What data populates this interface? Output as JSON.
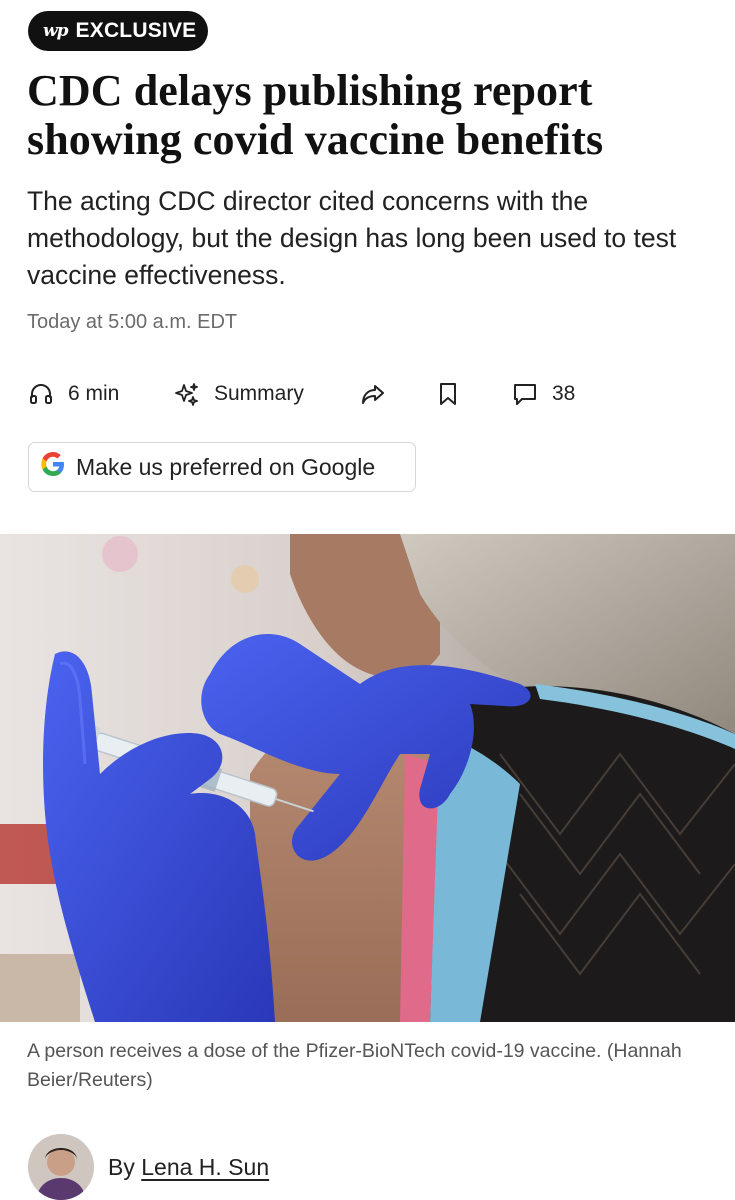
{
  "badge": {
    "logo": "wp",
    "label": "EXCLUSIVE"
  },
  "article": {
    "headline": "CDC delays publishing report showing covid vaccine benefits",
    "dek": "The acting CDC director cited concerns with the methodology, but the design has long been used to test vaccine effectiveness.",
    "timestamp": "Today at 5:00 a.m. EDT"
  },
  "actions": {
    "listen": {
      "icon": "headphones-icon",
      "label": "6 min"
    },
    "summary": {
      "icon": "sparkle-icon",
      "label": "Summary"
    },
    "share": {
      "icon": "share-icon"
    },
    "save": {
      "icon": "bookmark-icon"
    },
    "comments": {
      "icon": "comment-icon",
      "count": "38"
    }
  },
  "google_button": {
    "icon": "google-g-icon",
    "label": "Make us preferred on Google"
  },
  "photo": {
    "caption": "A person receives a dose of the Pfizer-BioNTech covid-19 vaccine. (Hannah Beier/Reuters)"
  },
  "byline": {
    "prefix": "By",
    "author": "Lena H. Sun"
  },
  "colors": {
    "badge_bg": "#111111",
    "glove_blue": "#3a4fd8",
    "text_gray": "#6b6b6b"
  }
}
